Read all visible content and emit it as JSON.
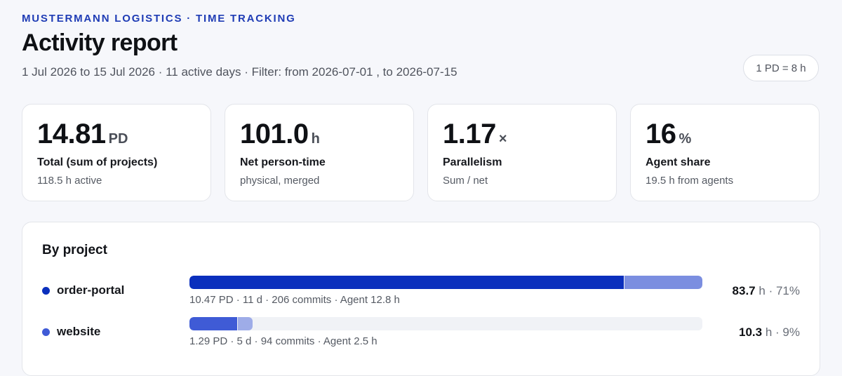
{
  "header": {
    "eyebrow": "MUSTERMANN LOGISTICS · TIME TRACKING",
    "title": "Activity report",
    "subtitle": "1 Jul 2026 to 15 Jul 2026 · 11 active days · Filter: from 2026-07-01 , to 2026-07-15",
    "pd_badge": "1 PD = 8 h"
  },
  "stats": [
    {
      "value": "14.81",
      "unit": "PD",
      "label": "Total (sum of projects)",
      "sub": "118.5 h active"
    },
    {
      "value": "101.0",
      "unit": "h",
      "label": "Net person-time",
      "sub": "physical, merged"
    },
    {
      "value": "1.17",
      "unit": "×",
      "label": "Parallelism",
      "sub": "Sum / net"
    },
    {
      "value": "16",
      "unit": "%",
      "label": "Agent share",
      "sub": "19.5 h from agents"
    }
  ],
  "projects": {
    "title": "By project",
    "items": [
      {
        "name": "order-portal",
        "meta": "10.47 PD · 11 d · 206 commits · Agent 12.8 h",
        "hours": "83.7",
        "hours_unit": "h",
        "share": "· 71%",
        "bar_fraction": 1.0,
        "agent_fraction_of_bar": 0.153,
        "color": "#0a2fbd",
        "agent_color": "#7b8ee0"
      },
      {
        "name": "website",
        "meta": "1.29 PD · 5 d · 94 commits · Agent 2.5 h",
        "hours": "10.3",
        "hours_unit": "h",
        "share": "· 9%",
        "bar_fraction": 0.123,
        "agent_fraction_of_bar": 0.243,
        "color": "#3f5bd6",
        "agent_color": "#9eace8"
      }
    ]
  }
}
